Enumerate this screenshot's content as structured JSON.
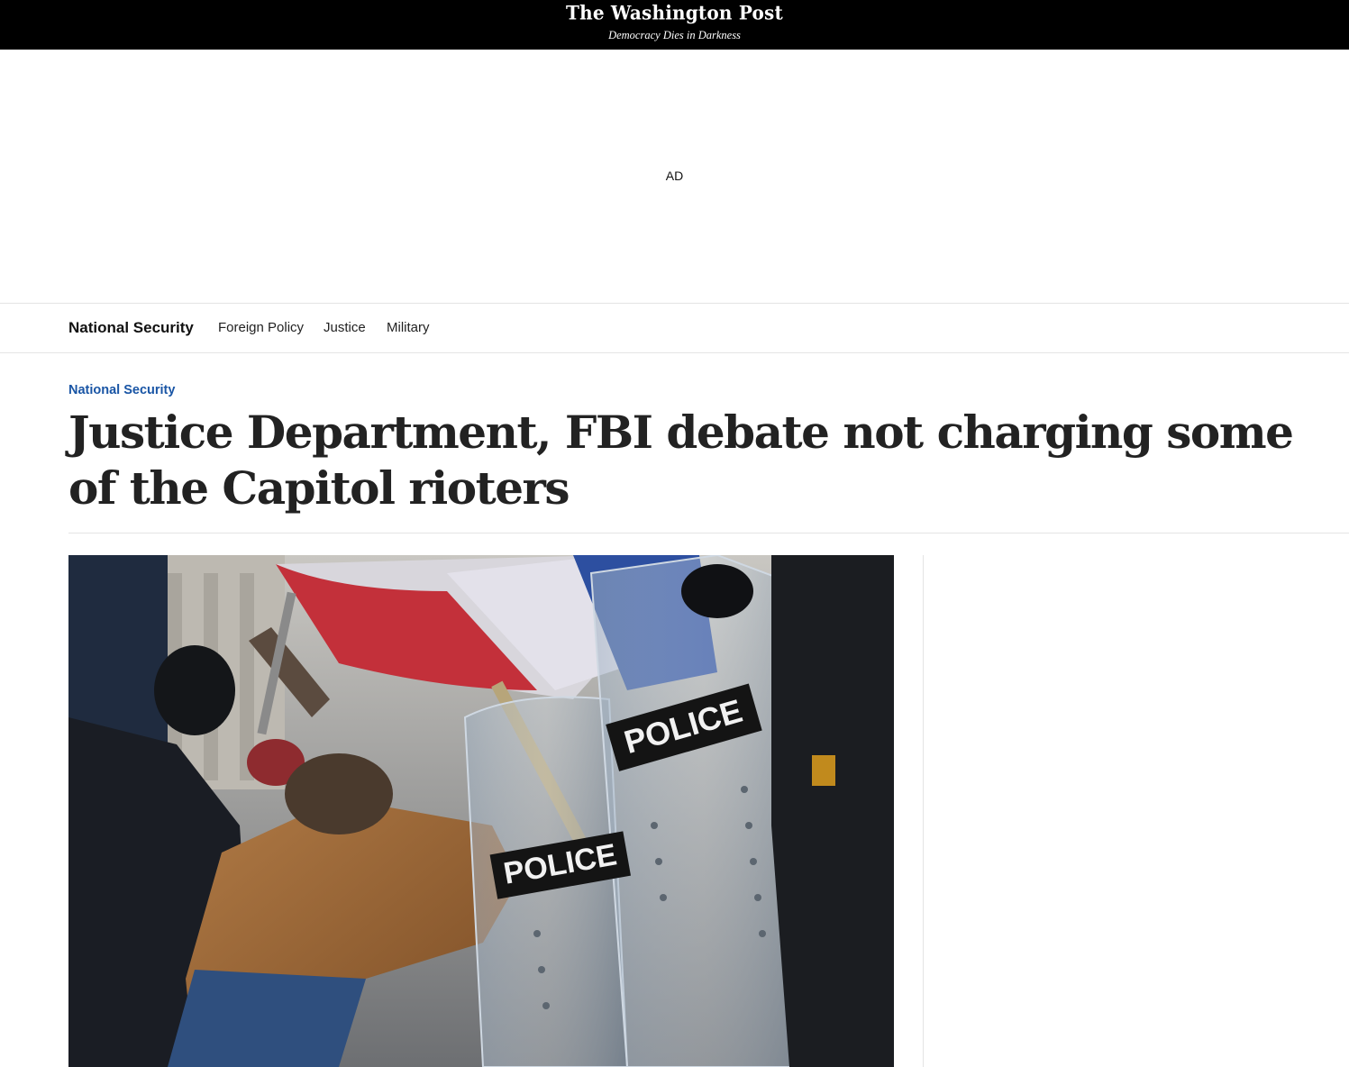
{
  "masthead": {
    "logo_text": "The Washington Post",
    "tagline": "Democracy Dies in Darkness"
  },
  "ad": {
    "label": "AD"
  },
  "section_nav": {
    "title": "National Security",
    "items": [
      {
        "label": "Foreign Policy"
      },
      {
        "label": "Justice"
      },
      {
        "label": "Military"
      }
    ]
  },
  "article": {
    "kicker": "National Security",
    "headline": "Justice Department, FBI debate not charging some of the Capitol rioters"
  },
  "photo": {
    "shield_text": "POLICE"
  },
  "colors": {
    "masthead_bg": "#000000",
    "kicker": "#1955a5",
    "headline": "#222222",
    "divider": "#e4e4e4"
  }
}
